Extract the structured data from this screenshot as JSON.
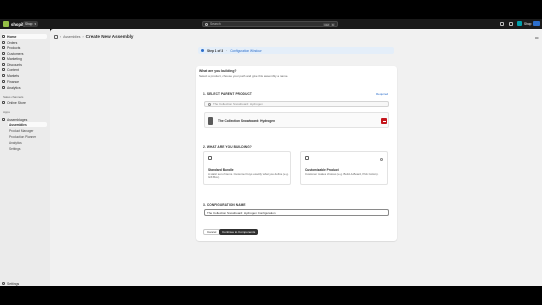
{
  "topbar": {
    "brand": "shopify",
    "store": "Shop",
    "search_placeholder": "Search",
    "shortcut_keys": [
      "Ctrl",
      "K"
    ],
    "account_name": "Shop"
  },
  "sidebar": {
    "items": [
      {
        "label": "Home",
        "icon": "home-icon"
      },
      {
        "label": "Orders",
        "icon": "orders-icon"
      },
      {
        "label": "Products",
        "icon": "tag-icon"
      },
      {
        "label": "Customers",
        "icon": "person-icon"
      },
      {
        "label": "Marketing",
        "icon": "target-icon"
      },
      {
        "label": "Discounts",
        "icon": "discount-icon"
      },
      {
        "label": "Content",
        "icon": "content-icon"
      },
      {
        "label": "Markets",
        "icon": "globe-icon"
      },
      {
        "label": "Finance",
        "icon": "bank-icon"
      },
      {
        "label": "Analytics",
        "icon": "chart-icon"
      }
    ],
    "sales_channels_heading": "Sales channels",
    "sales_channels": [
      {
        "label": "Online Store",
        "icon": "store-icon"
      }
    ],
    "apps_heading": "Apps",
    "app": {
      "label": "Assemblages",
      "icon": "app-icon"
    },
    "app_subitems": [
      "Assemblies",
      "Product Manager",
      "Production Planner",
      "Analytics",
      "Settings"
    ],
    "settings_label": "Settings"
  },
  "breadcrumb": {
    "parent": "Assemblies",
    "separator": "›",
    "title": "Create New Assembly"
  },
  "banner": {
    "step": "Step 1 of 3",
    "separator": "·",
    "link": "Configuration Window"
  },
  "form": {
    "question": "What are you building?",
    "question_sub": "Select a product, choose your path and give this assembly a name.",
    "section1": {
      "title": "1. SELECT PARENT PRODUCT",
      "required": "Required",
      "search_placeholder": "The Collection Snowboard: Hydrogen",
      "selected_product": "The Collection Snowboard: Hydrogen"
    },
    "section2": {
      "title": "2. WHAT ARE YOU BUILDING?",
      "options": [
        {
          "title": "Standard Bundle",
          "desc": "A static set of items. Customer buys exactly what you define (e.g. Gift Box)."
        },
        {
          "title": "Customizable Product",
          "desc": "Customer makes choices (e.g. Build-A-Board, Pick Colors)."
        }
      ]
    },
    "section3": {
      "title": "3. CONFIGURATION NAME",
      "value": "The Collection Snowboard: Hydrogen Configuration"
    },
    "cancel_label": "Cancel",
    "continue_label": "Continue to Components"
  },
  "colors": {
    "brand_green": "#95bf47",
    "accent_blue": "#2c6ecb",
    "danger": "#c4161c",
    "primary_button": "#303030"
  }
}
